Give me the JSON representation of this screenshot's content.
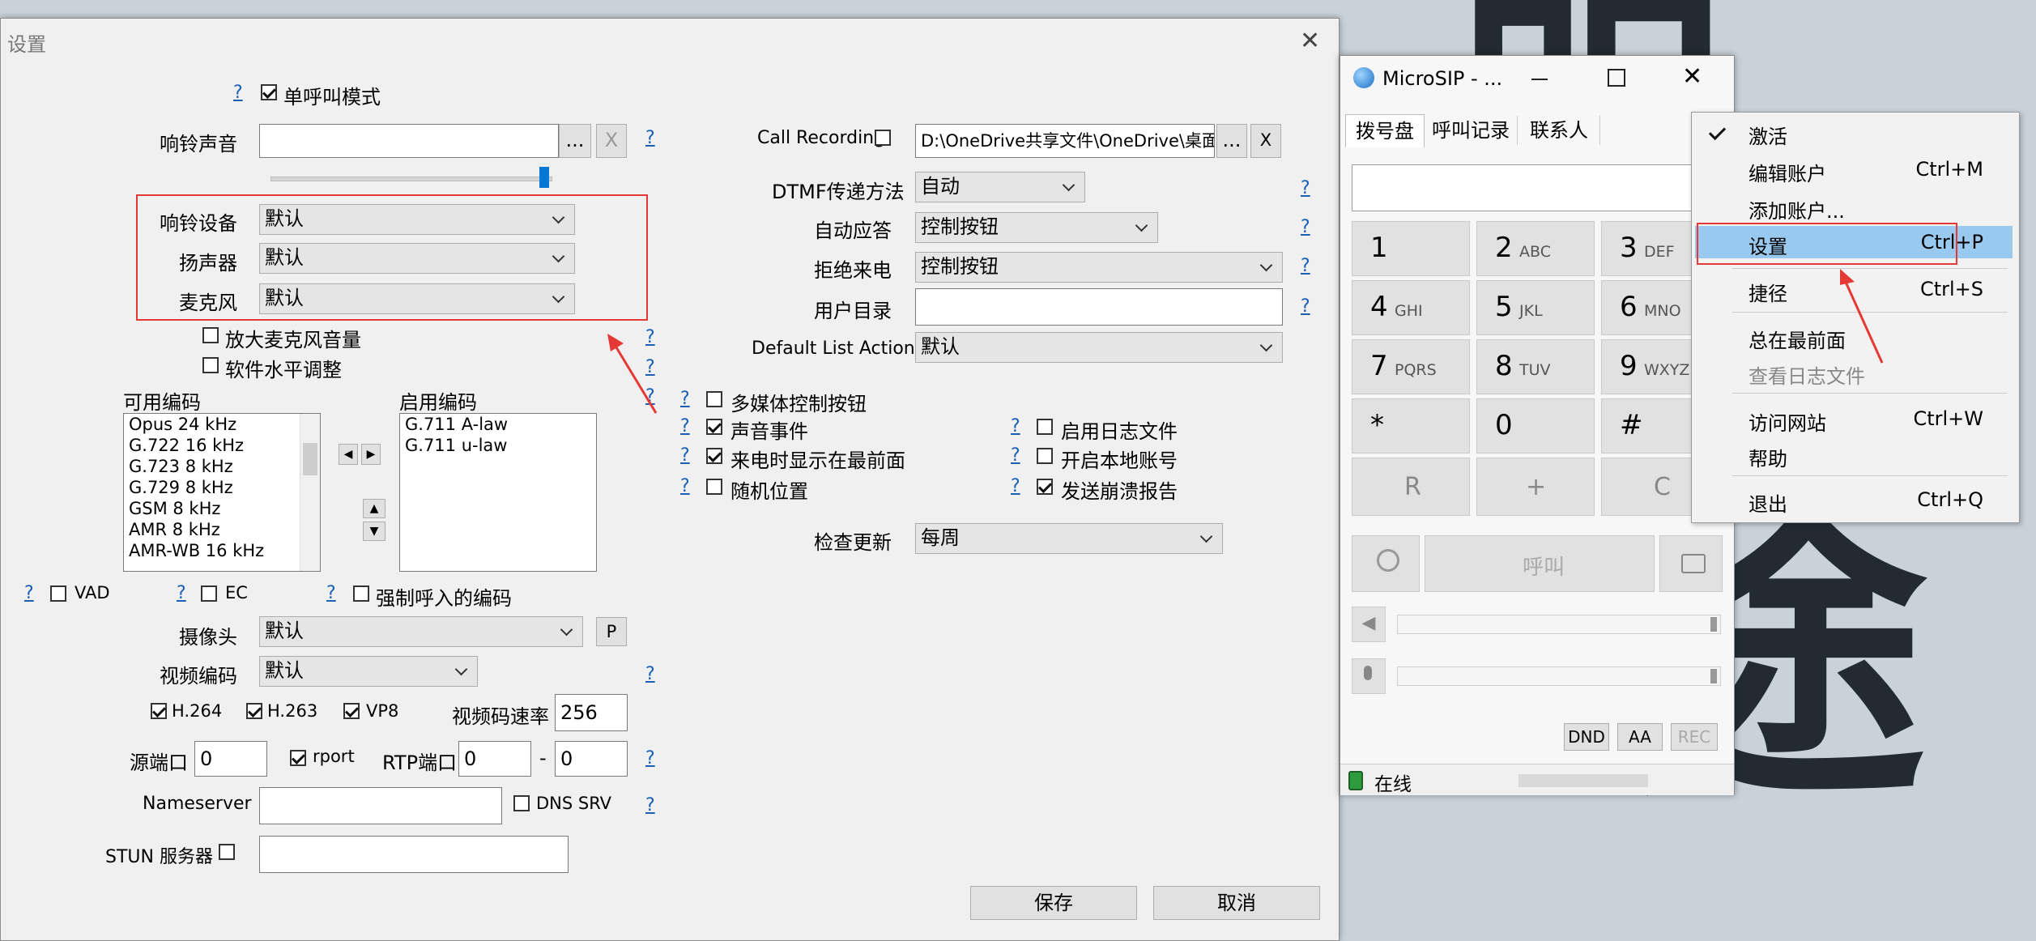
{
  "settings": {
    "title": "设置",
    "single_call_mode": "单呼叫模式",
    "ringtone_label": "响铃声音",
    "browse": "...",
    "clear": "X",
    "ring_device_label": "响铃设备",
    "ring_device_value": "默认",
    "speaker_label": "扬声器",
    "speaker_value": "默认",
    "mic_label": "麦克风",
    "mic_value": "默认",
    "mic_boost": "放大麦克风音量",
    "software_level": "软件水平调整",
    "available_codecs_label": "可用编码",
    "available_codecs": [
      "Opus 24 kHz",
      "G.722 16 kHz",
      "G.723 8 kHz",
      "G.729 8 kHz",
      "GSM 8 kHz",
      "AMR 8 kHz",
      "AMR-WB 16 kHz"
    ],
    "enabled_codecs_label": "启用编码",
    "enabled_codecs": [
      "G.711 A-law",
      "G.711 u-law"
    ],
    "vad": "VAD",
    "ec": "EC",
    "force_codec": "强制呼入的编码",
    "camera_label": "摄像头",
    "camera_value": "默认",
    "camera_btn": "P",
    "video_codec_label": "视频编码",
    "video_codec_value": "默认",
    "h264": "H.264",
    "h263": "H.263",
    "vp8": "VP8",
    "video_bitrate_label": "视频码速率",
    "video_bitrate_value": "256",
    "source_port_label": "源端口",
    "source_port_value": "0",
    "rport": "rport",
    "rtp_port_label": "RTP端口",
    "rtp_port_from": "0",
    "rtp_dash": "-",
    "rtp_port_to": "0",
    "nameserver_label": "Nameserver",
    "dns_srv": "DNS SRV",
    "stun_label": "STUN 服务器",
    "call_recording_label": "Call Recording",
    "recording_path": "D:\\OneDrive共享文件\\OneDrive\\桌面",
    "dtmf_label": "DTMF传递方法",
    "dtmf_value": "自动",
    "auto_answer_label": "自动应答",
    "auto_answer_value": "控制按钮",
    "reject_label": "拒绝来电",
    "reject_value": "控制按钮",
    "user_dir_label": "用户目录",
    "default_list_label": "Default List Action",
    "default_list_value": "默认",
    "media_buttons": "多媒体控制按钮",
    "sound_events": "声音事件",
    "bring_to_front": "来电时显示在最前面",
    "random_position": "随机位置",
    "enable_log": "启用日志文件",
    "local_account": "开启本地账号",
    "crash_report": "发送崩溃报告",
    "check_updates_label": "检查更新",
    "check_updates_value": "每周",
    "help_mark": "?",
    "save": "保存",
    "cancel": "取消"
  },
  "microsip": {
    "title": "MicroSIP - ...",
    "tabs": [
      "拨号盘",
      "呼叫记录",
      "联系人"
    ],
    "keys": [
      {
        "d": "1",
        "s": ""
      },
      {
        "d": "2",
        "s": "ABC"
      },
      {
        "d": "3",
        "s": "DEF"
      },
      {
        "d": "4",
        "s": "GHI"
      },
      {
        "d": "5",
        "s": "JKL"
      },
      {
        "d": "6",
        "s": "MNO"
      },
      {
        "d": "7",
        "s": "PQRS"
      },
      {
        "d": "8",
        "s": "TUV"
      },
      {
        "d": "9",
        "s": "WXYZ"
      },
      {
        "d": "*",
        "s": ""
      },
      {
        "d": "0",
        "s": ""
      },
      {
        "d": "#",
        "s": ""
      }
    ],
    "redial": "R",
    "plus": "+",
    "clear_key": "C",
    "call": "呼叫",
    "dnd": "DND",
    "aa": "AA",
    "rec": "REC",
    "status": "在线"
  },
  "menu": {
    "items": [
      {
        "label": "激活",
        "shortcut": ""
      },
      {
        "label": "编辑账户",
        "shortcut": "Ctrl+M"
      },
      {
        "label": "添加账户...",
        "shortcut": ""
      },
      {
        "label": "设置",
        "shortcut": "Ctrl+P"
      },
      {
        "label": "捷径",
        "shortcut": "Ctrl+S"
      },
      {
        "label": "总在最前面",
        "shortcut": ""
      },
      {
        "label": "查看日志文件",
        "shortcut": ""
      },
      {
        "label": "访问网站",
        "shortcut": "Ctrl+W"
      },
      {
        "label": "帮助",
        "shortcut": ""
      },
      {
        "label": "退出",
        "shortcut": "Ctrl+Q"
      }
    ]
  },
  "colors": {
    "highlight": "#99c9ef",
    "annotation": "#e53935",
    "link": "#1a5fb4"
  }
}
